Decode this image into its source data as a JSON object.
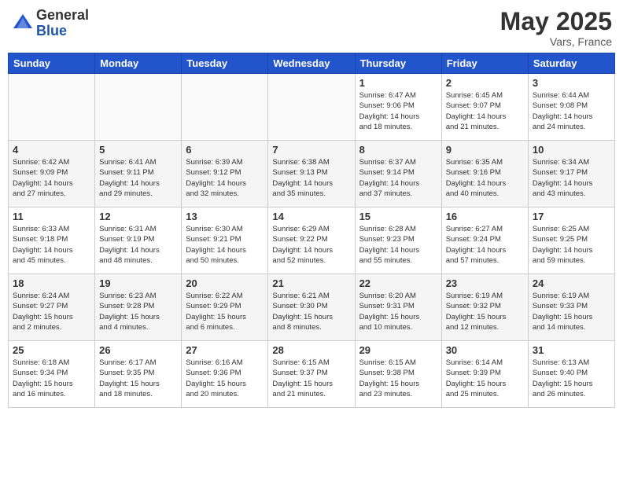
{
  "header": {
    "logo_general": "General",
    "logo_blue": "Blue",
    "month_year": "May 2025",
    "location": "Vars, France"
  },
  "days_of_week": [
    "Sunday",
    "Monday",
    "Tuesday",
    "Wednesday",
    "Thursday",
    "Friday",
    "Saturday"
  ],
  "weeks": [
    [
      {
        "day": "",
        "info": ""
      },
      {
        "day": "",
        "info": ""
      },
      {
        "day": "",
        "info": ""
      },
      {
        "day": "",
        "info": ""
      },
      {
        "day": "1",
        "info": "Sunrise: 6:47 AM\nSunset: 9:06 PM\nDaylight: 14 hours\nand 18 minutes."
      },
      {
        "day": "2",
        "info": "Sunrise: 6:45 AM\nSunset: 9:07 PM\nDaylight: 14 hours\nand 21 minutes."
      },
      {
        "day": "3",
        "info": "Sunrise: 6:44 AM\nSunset: 9:08 PM\nDaylight: 14 hours\nand 24 minutes."
      }
    ],
    [
      {
        "day": "4",
        "info": "Sunrise: 6:42 AM\nSunset: 9:09 PM\nDaylight: 14 hours\nand 27 minutes."
      },
      {
        "day": "5",
        "info": "Sunrise: 6:41 AM\nSunset: 9:11 PM\nDaylight: 14 hours\nand 29 minutes."
      },
      {
        "day": "6",
        "info": "Sunrise: 6:39 AM\nSunset: 9:12 PM\nDaylight: 14 hours\nand 32 minutes."
      },
      {
        "day": "7",
        "info": "Sunrise: 6:38 AM\nSunset: 9:13 PM\nDaylight: 14 hours\nand 35 minutes."
      },
      {
        "day": "8",
        "info": "Sunrise: 6:37 AM\nSunset: 9:14 PM\nDaylight: 14 hours\nand 37 minutes."
      },
      {
        "day": "9",
        "info": "Sunrise: 6:35 AM\nSunset: 9:16 PM\nDaylight: 14 hours\nand 40 minutes."
      },
      {
        "day": "10",
        "info": "Sunrise: 6:34 AM\nSunset: 9:17 PM\nDaylight: 14 hours\nand 43 minutes."
      }
    ],
    [
      {
        "day": "11",
        "info": "Sunrise: 6:33 AM\nSunset: 9:18 PM\nDaylight: 14 hours\nand 45 minutes."
      },
      {
        "day": "12",
        "info": "Sunrise: 6:31 AM\nSunset: 9:19 PM\nDaylight: 14 hours\nand 48 minutes."
      },
      {
        "day": "13",
        "info": "Sunrise: 6:30 AM\nSunset: 9:21 PM\nDaylight: 14 hours\nand 50 minutes."
      },
      {
        "day": "14",
        "info": "Sunrise: 6:29 AM\nSunset: 9:22 PM\nDaylight: 14 hours\nand 52 minutes."
      },
      {
        "day": "15",
        "info": "Sunrise: 6:28 AM\nSunset: 9:23 PM\nDaylight: 14 hours\nand 55 minutes."
      },
      {
        "day": "16",
        "info": "Sunrise: 6:27 AM\nSunset: 9:24 PM\nDaylight: 14 hours\nand 57 minutes."
      },
      {
        "day": "17",
        "info": "Sunrise: 6:25 AM\nSunset: 9:25 PM\nDaylight: 14 hours\nand 59 minutes."
      }
    ],
    [
      {
        "day": "18",
        "info": "Sunrise: 6:24 AM\nSunset: 9:27 PM\nDaylight: 15 hours\nand 2 minutes."
      },
      {
        "day": "19",
        "info": "Sunrise: 6:23 AM\nSunset: 9:28 PM\nDaylight: 15 hours\nand 4 minutes."
      },
      {
        "day": "20",
        "info": "Sunrise: 6:22 AM\nSunset: 9:29 PM\nDaylight: 15 hours\nand 6 minutes."
      },
      {
        "day": "21",
        "info": "Sunrise: 6:21 AM\nSunset: 9:30 PM\nDaylight: 15 hours\nand 8 minutes."
      },
      {
        "day": "22",
        "info": "Sunrise: 6:20 AM\nSunset: 9:31 PM\nDaylight: 15 hours\nand 10 minutes."
      },
      {
        "day": "23",
        "info": "Sunrise: 6:19 AM\nSunset: 9:32 PM\nDaylight: 15 hours\nand 12 minutes."
      },
      {
        "day": "24",
        "info": "Sunrise: 6:19 AM\nSunset: 9:33 PM\nDaylight: 15 hours\nand 14 minutes."
      }
    ],
    [
      {
        "day": "25",
        "info": "Sunrise: 6:18 AM\nSunset: 9:34 PM\nDaylight: 15 hours\nand 16 minutes."
      },
      {
        "day": "26",
        "info": "Sunrise: 6:17 AM\nSunset: 9:35 PM\nDaylight: 15 hours\nand 18 minutes."
      },
      {
        "day": "27",
        "info": "Sunrise: 6:16 AM\nSunset: 9:36 PM\nDaylight: 15 hours\nand 20 minutes."
      },
      {
        "day": "28",
        "info": "Sunrise: 6:15 AM\nSunset: 9:37 PM\nDaylight: 15 hours\nand 21 minutes."
      },
      {
        "day": "29",
        "info": "Sunrise: 6:15 AM\nSunset: 9:38 PM\nDaylight: 15 hours\nand 23 minutes."
      },
      {
        "day": "30",
        "info": "Sunrise: 6:14 AM\nSunset: 9:39 PM\nDaylight: 15 hours\nand 25 minutes."
      },
      {
        "day": "31",
        "info": "Sunrise: 6:13 AM\nSunset: 9:40 PM\nDaylight: 15 hours\nand 26 minutes."
      }
    ]
  ]
}
